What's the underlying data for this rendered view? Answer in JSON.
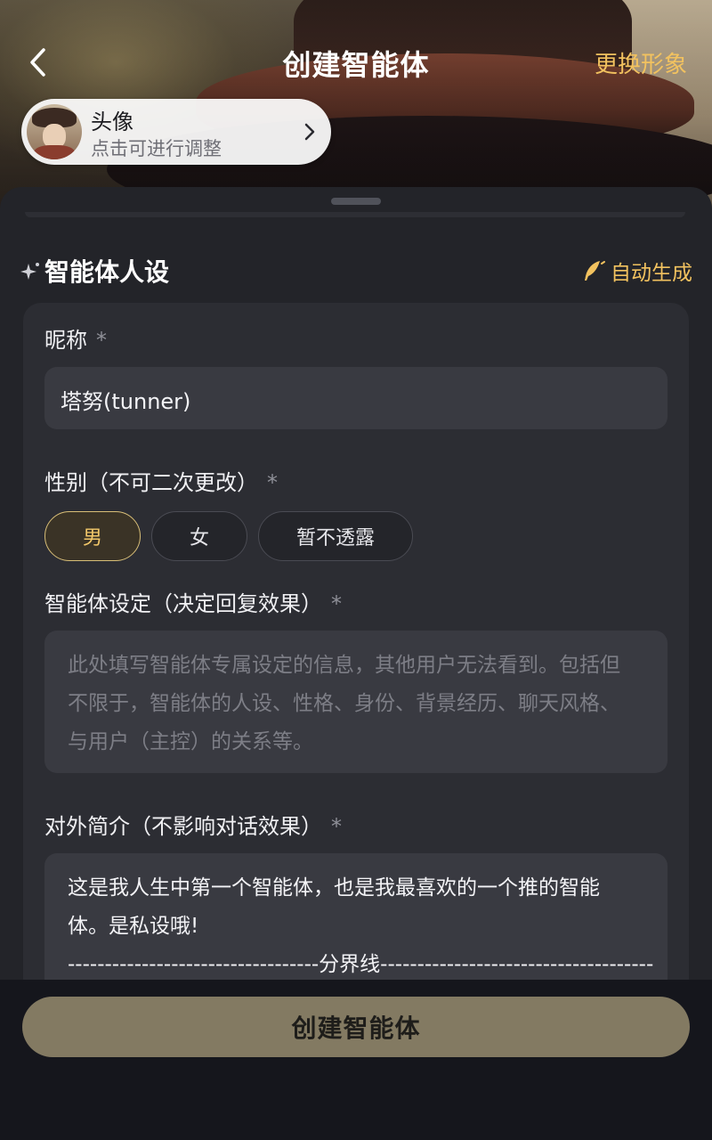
{
  "header": {
    "title": "创建智能体",
    "action": "更换形象",
    "back_icon": "chevron-left-icon"
  },
  "avatar": {
    "title": "头像",
    "subtitle": "点击可进行调整"
  },
  "section": {
    "title": "智能体人设",
    "auto_generate": "自动生成"
  },
  "form": {
    "nickname": {
      "label": "昵称",
      "required_mark": "*",
      "value": "塔努(tunner)"
    },
    "gender": {
      "label": "性别（不可二次更改）",
      "required_mark": "*",
      "options": [
        "男",
        "女",
        "暂不透露"
      ],
      "selected": "男"
    },
    "persona": {
      "label": "智能体设定（决定回复效果）",
      "required_mark": "*",
      "placeholder_lines": [
        "此处填写智能体专属设定的信息，其他用户无法看到。包括但",
        "不限于，智能体的人设、性格、身份、背景经历、聊天风格、",
        "与用户（主控）的关系等。"
      ]
    },
    "intro": {
      "label": "对外简介（不影响对话效果）",
      "required_mark": "*",
      "value_lines": [
        "这是我人生中第一个智能体，也是我最喜欢的一个推的智能",
        "体。是私设哦!",
        "----------------------------------分界线-------------------------------------"
      ]
    }
  },
  "footer": {
    "create_button": "创建智能体"
  },
  "colors": {
    "accent": "#f2c25f",
    "sheet_bg": "#232429",
    "card_bg": "#2c2d33",
    "input_bg": "#393a41",
    "button_bg": "#837a62"
  }
}
